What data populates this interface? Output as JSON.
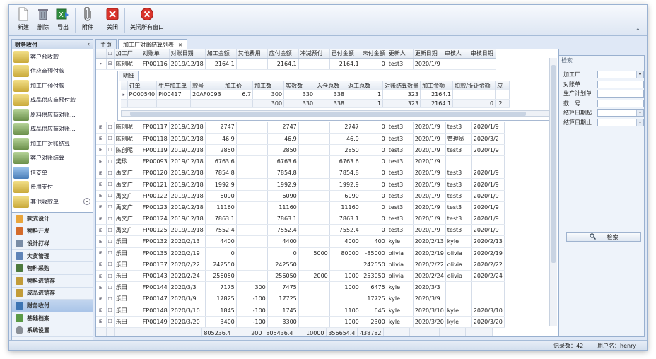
{
  "toolbar": {
    "buttons": [
      "新建",
      "删除",
      "导出",
      "附件",
      "关闭",
      "关闭所有窗口"
    ]
  },
  "sidebar": {
    "title": "财务收付",
    "collapse": "‹",
    "items": [
      "客户预收款",
      "供应商预付款",
      "加工厂预付款",
      "成品供应商预付款",
      "原料供应商对账...",
      "成品供应商对账...",
      "加工厂对账结算",
      "客户对账结算",
      "借支单",
      "费用支付",
      "其他收款单"
    ],
    "sections": [
      "款式设计",
      "物料开发",
      "设计打样",
      "大货管理",
      "物料采购",
      "物料进销存",
      "成品进销存",
      "财务收付",
      "基础档案",
      "系统设置"
    ],
    "active_section": "财务收付"
  },
  "tabs": [
    "主页",
    "加工厂对账结算列表"
  ],
  "grid": {
    "columns": [
      "加工厂",
      "对账单",
      "对账日期",
      "加工金额",
      "其他费用",
      "应付金额",
      "冲减预付",
      "已付金额",
      "未付金额",
      "更新人",
      "更新日期",
      "审核人",
      "审核日期"
    ],
    "expanded_row": [
      "陈创昵",
      "FP00116",
      "2019/12/18",
      "2164.1",
      "",
      "2164.1",
      "",
      "2164.1",
      "0",
      "test3",
      "2020/1/9",
      "",
      ""
    ],
    "detail": {
      "tab": "明细",
      "columns": [
        "订单",
        "生产加工单",
        "款号",
        "加工价",
        "加工数",
        "实数数",
        "入仓总数",
        "返工总数",
        "对账结算数量",
        "加工金额",
        "扣款/折让金额",
        "应"
      ],
      "row": [
        "PO00540",
        "PI00417",
        "20AF0093",
        "6.7",
        "300",
        "330",
        "338",
        "1",
        "323",
        "2164.1",
        "",
        ""
      ],
      "totals": [
        "",
        "",
        "",
        "",
        "300",
        "330",
        "338",
        "1",
        "323",
        "2164.1",
        "0",
        "2..."
      ]
    },
    "rows": [
      [
        "陈创昵",
        "FP00117",
        "2019/12/18",
        "2747",
        "",
        "2747",
        "",
        "2747",
        "0",
        "test3",
        "2020/1/9",
        "test3",
        "2020/1/9"
      ],
      [
        "陈创昵",
        "FP00118",
        "2019/12/18",
        "46.9",
        "",
        "46.9",
        "",
        "46.9",
        "0",
        "test3",
        "2020/1/9",
        "管理员",
        "2020/3/2"
      ],
      [
        "陈创昵",
        "FP00119",
        "2019/12/18",
        "2850",
        "",
        "2850",
        "",
        "2850",
        "0",
        "test3",
        "2020/1/9",
        "test3",
        "2020/1/9"
      ],
      [
        "樊珍",
        "FP00093",
        "2019/12/18",
        "6763.6",
        "",
        "6763.6",
        "",
        "6763.6",
        "0",
        "test3",
        "2020/1/9",
        "",
        ""
      ],
      [
        "禹文广",
        "FP00120",
        "2019/12/18",
        "7854.8",
        "",
        "7854.8",
        "",
        "7854.8",
        "0",
        "test3",
        "2020/1/9",
        "test3",
        "2020/1/9"
      ],
      [
        "禹文广",
        "FP00121",
        "2019/12/18",
        "1992.9",
        "",
        "1992.9",
        "",
        "1992.9",
        "0",
        "test3",
        "2020/1/9",
        "test3",
        "2020/1/9"
      ],
      [
        "禹文广",
        "FP00122",
        "2019/12/18",
        "6090",
        "",
        "6090",
        "",
        "6090",
        "0",
        "test3",
        "2020/1/9",
        "test3",
        "2020/1/9"
      ],
      [
        "禹文广",
        "FP00123",
        "2019/12/18",
        "11160",
        "",
        "11160",
        "",
        "11160",
        "0",
        "test3",
        "2020/1/9",
        "test3",
        "2020/1/9"
      ],
      [
        "禹文广",
        "FP00124",
        "2019/12/18",
        "7863.1",
        "",
        "7863.1",
        "",
        "7863.1",
        "0",
        "test3",
        "2020/1/9",
        "test3",
        "2020/1/9"
      ],
      [
        "禹文广",
        "FP00125",
        "2019/12/18",
        "7552.4",
        "",
        "7552.4",
        "",
        "7552.4",
        "0",
        "test3",
        "2020/1/9",
        "test3",
        "2020/1/9"
      ],
      [
        "乐田",
        "FP00132",
        "2020/2/13",
        "4400",
        "",
        "4400",
        "",
        "4000",
        "400",
        "kyle",
        "2020/2/13",
        "kyle",
        "2020/2/13"
      ],
      [
        "乐田",
        "FP00135",
        "2020/2/19",
        "0",
        "",
        "0",
        "5000",
        "80000",
        "-85000",
        "olivia",
        "2020/2/19",
        "olivia",
        "2020/2/19"
      ],
      [
        "乐田",
        "FP00137",
        "2020/2/22",
        "242550",
        "",
        "242550",
        "",
        "",
        "242550",
        "olivia",
        "2020/2/22",
        "olivia",
        "2020/2/22"
      ],
      [
        "乐田",
        "FP00143",
        "2020/2/24",
        "256050",
        "",
        "256050",
        "2000",
        "1000",
        "253050",
        "olivia",
        "2020/2/24",
        "olivia",
        "2020/2/24"
      ],
      [
        "乐田",
        "FP00144",
        "2020/3/3",
        "7175",
        "300",
        "7475",
        "",
        "1000",
        "6475",
        "kyle",
        "2020/3/3",
        "",
        ""
      ],
      [
        "乐田",
        "FP00147",
        "2020/3/9",
        "17825",
        "-100",
        "17725",
        "",
        "",
        "17725",
        "kyle",
        "2020/3/9",
        "",
        ""
      ],
      [
        "乐田",
        "FP00148",
        "2020/3/10",
        "1845",
        "-100",
        "1745",
        "",
        "1100",
        "645",
        "kyle",
        "2020/3/10",
        "kyle",
        "2020/3/10"
      ],
      [
        "乐田",
        "FP00149",
        "2020/3/20",
        "3400",
        "-100",
        "3300",
        "",
        "1000",
        "2300",
        "kyle",
        "2020/3/20",
        "kyle",
        "2020/3/20"
      ]
    ],
    "totals": [
      "",
      "",
      "",
      "805236.4",
      "200",
      "805436.4",
      "10000",
      "356654.4",
      "438782",
      "",
      "",
      "",
      ""
    ]
  },
  "search": {
    "title": "检索",
    "fields": [
      "加工厂",
      "对账单",
      "生产计划单",
      "款　号",
      "结算日期起",
      "结算日期止"
    ],
    "button": "检索"
  },
  "status": {
    "records_label": "记录数：",
    "records": "42",
    "user_label": "用户名：",
    "user": "henry"
  }
}
